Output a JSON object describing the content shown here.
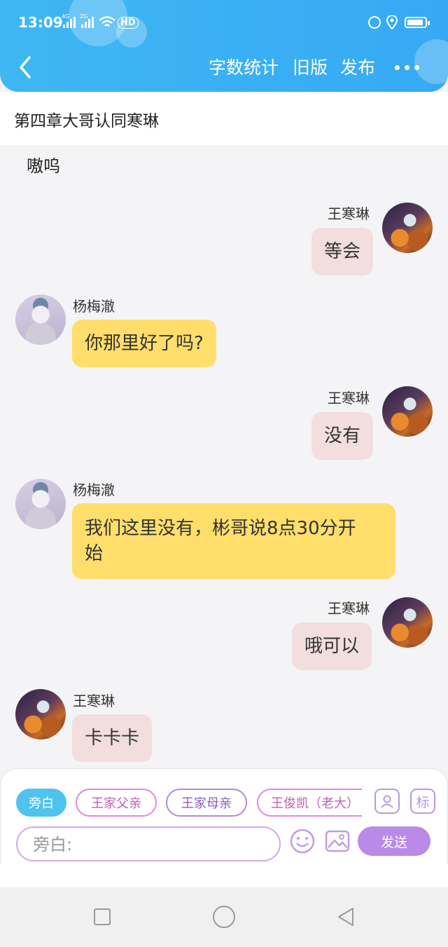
{
  "status_bar": {
    "time": "13:09",
    "net_4g": "4G",
    "net_2g": "2G",
    "hd": "HD"
  },
  "header": {
    "word_count": "字数统计",
    "old_version": "旧版",
    "publish": "发布"
  },
  "chapter": {
    "title": "第四章大哥认同寒琳"
  },
  "chat": {
    "truncated_text": "嗷呜",
    "messages": [
      {
        "name": "王寒琳",
        "text": "等会"
      },
      {
        "name": "杨梅澈",
        "text": "你那里好了吗?"
      },
      {
        "name": "王寒琳",
        "text": "没有"
      },
      {
        "name": "杨梅澈",
        "text_line1": "我们这里没有，彬哥说8点30分开",
        "text_line2": "始"
      },
      {
        "name": "王寒琳",
        "text": "哦可以"
      },
      {
        "name": "王寒琳",
        "text": "卡卡卡"
      }
    ]
  },
  "panel": {
    "chips": [
      "旁白",
      "王家父亲",
      "王家母亲",
      "王俊凯（老大）"
    ],
    "tag_button": "标",
    "input_placeholder": "旁白:",
    "send": "发送"
  },
  "colors": {
    "header": "#3fb7f2",
    "pink_bubble": "#f2dede",
    "yellow_bubble": "#ffde6c",
    "send_button": "#b98ae8",
    "active_chip": "#4fc3ee"
  }
}
